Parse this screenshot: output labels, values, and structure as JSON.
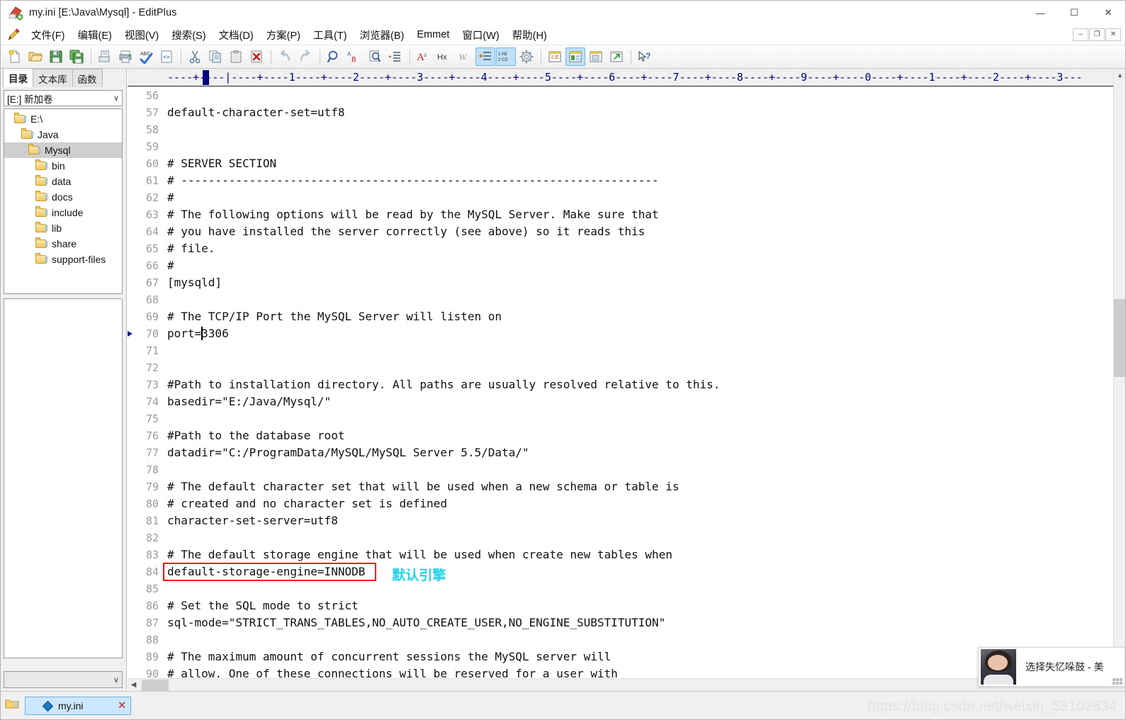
{
  "window": {
    "title": "my.ini [E:\\Java\\Mysql] - EditPlus",
    "app_icon": "editplus-icon",
    "controls": {
      "minimize": "—",
      "maximize": "☐",
      "close": "✕"
    },
    "mdi_controls": {
      "minimize": "–",
      "restore": "❐",
      "close": "✕"
    }
  },
  "menubar": {
    "items": [
      {
        "label": "文件(F)",
        "name": "menu-file"
      },
      {
        "label": "编辑(E)",
        "name": "menu-edit"
      },
      {
        "label": "视图(V)",
        "name": "menu-view"
      },
      {
        "label": "搜索(S)",
        "name": "menu-search"
      },
      {
        "label": "文档(D)",
        "name": "menu-document"
      },
      {
        "label": "方案(P)",
        "name": "menu-project"
      },
      {
        "label": "工具(T)",
        "name": "menu-tools"
      },
      {
        "label": "浏览器(B)",
        "name": "menu-browser"
      },
      {
        "label": "Emmet",
        "name": "menu-emmet"
      },
      {
        "label": "窗口(W)",
        "name": "menu-window"
      },
      {
        "label": "帮助(H)",
        "name": "menu-help"
      }
    ]
  },
  "toolbar": {
    "buttons": [
      {
        "name": "new-file-icon",
        "glyph": "new",
        "active": false
      },
      {
        "name": "open-file-icon",
        "glyph": "open",
        "active": false
      },
      {
        "name": "save-icon",
        "glyph": "save",
        "active": false
      },
      {
        "name": "save-all-icon",
        "glyph": "saveall",
        "active": false
      },
      {
        "name": "sep",
        "glyph": "sep",
        "active": false
      },
      {
        "name": "print-preview-icon",
        "glyph": "preview",
        "active": false
      },
      {
        "name": "print-icon",
        "glyph": "print",
        "active": false
      },
      {
        "name": "spell-check-icon",
        "glyph": "spell",
        "active": false
      },
      {
        "name": "html-tag-icon",
        "glyph": "tag",
        "active": false
      },
      {
        "name": "sep",
        "glyph": "sep",
        "active": false
      },
      {
        "name": "cut-icon",
        "glyph": "cut",
        "active": false
      },
      {
        "name": "copy-icon",
        "glyph": "copy",
        "active": false
      },
      {
        "name": "paste-icon",
        "glyph": "paste",
        "active": false
      },
      {
        "name": "delete-icon",
        "glyph": "delete",
        "active": false
      },
      {
        "name": "sep",
        "glyph": "sep",
        "active": false
      },
      {
        "name": "undo-icon",
        "glyph": "undo",
        "active": false
      },
      {
        "name": "redo-icon",
        "glyph": "redo",
        "active": false
      },
      {
        "name": "sep",
        "glyph": "sep",
        "active": false
      },
      {
        "name": "find-icon",
        "glyph": "find",
        "active": false
      },
      {
        "name": "replace-icon",
        "glyph": "replace",
        "active": false
      },
      {
        "name": "find-in-files-icon",
        "glyph": "findfiles",
        "active": false
      },
      {
        "name": "goto-line-icon",
        "glyph": "goto",
        "active": false
      },
      {
        "name": "sep",
        "glyph": "sep",
        "active": false
      },
      {
        "name": "font-icon",
        "glyph": "font",
        "active": false
      },
      {
        "name": "hex-view-icon",
        "glyph": "hex",
        "active": false
      },
      {
        "name": "word-wrap-icon",
        "glyph": "wordwrap",
        "active": false
      },
      {
        "name": "indent-icon",
        "glyph": "indent",
        "active": true
      },
      {
        "name": "line-numbers-icon",
        "glyph": "linenum",
        "active": true
      },
      {
        "name": "preferences-icon",
        "glyph": "gear",
        "active": false
      },
      {
        "name": "sep",
        "glyph": "sep",
        "active": false
      },
      {
        "name": "directory-window-icon",
        "glyph": "dirwin",
        "active": false
      },
      {
        "name": "output-window-icon",
        "glyph": "outwin",
        "active": true
      },
      {
        "name": "clipboard-window-icon",
        "glyph": "clipwin",
        "active": false
      },
      {
        "name": "browser-preview-icon",
        "glyph": "browse",
        "active": false
      },
      {
        "name": "sep",
        "glyph": "sep",
        "active": false
      },
      {
        "name": "context-help-icon",
        "glyph": "help",
        "active": false
      }
    ]
  },
  "sidebar": {
    "tabs": [
      {
        "label": "目录",
        "selected": true
      },
      {
        "label": "文本库",
        "selected": false
      },
      {
        "label": "函数",
        "selected": false
      }
    ],
    "drive_selector": {
      "value": "[E:] 新加卷",
      "caret": "∨"
    },
    "tree": [
      {
        "label": "E:\\",
        "indent": 0,
        "selected": false
      },
      {
        "label": "Java",
        "indent": 1,
        "selected": false
      },
      {
        "label": "Mysql",
        "indent": 2,
        "selected": true
      },
      {
        "label": "bin",
        "indent": 3,
        "selected": false
      },
      {
        "label": "data",
        "indent": 3,
        "selected": false
      },
      {
        "label": "docs",
        "indent": 3,
        "selected": false
      },
      {
        "label": "include",
        "indent": 3,
        "selected": false
      },
      {
        "label": "lib",
        "indent": 3,
        "selected": false
      },
      {
        "label": "share",
        "indent": 3,
        "selected": false
      },
      {
        "label": "support-files",
        "indent": 3,
        "selected": false
      }
    ],
    "filter_combo": {
      "value": "",
      "caret": "∨"
    }
  },
  "ruler": {
    "text": "----+----|----+----1----+----2----+----3----+----4----+----5----+----6----+----7----+----8----+----9----+----0----+----1----+----2----+----3---",
    "cursor_column": 9
  },
  "editor": {
    "lines": [
      {
        "no": "56",
        "text": ""
      },
      {
        "no": "57",
        "text": "default-character-set=utf8"
      },
      {
        "no": "58",
        "text": ""
      },
      {
        "no": "59",
        "text": ""
      },
      {
        "no": "60",
        "text": "# SERVER SECTION"
      },
      {
        "no": "61",
        "text": "# ----------------------------------------------------------------------"
      },
      {
        "no": "62",
        "text": "#"
      },
      {
        "no": "63",
        "text": "# The following options will be read by the MySQL Server. Make sure that"
      },
      {
        "no": "64",
        "text": "# you have installed the server correctly (see above) so it reads this"
      },
      {
        "no": "65",
        "text": "# file."
      },
      {
        "no": "66",
        "text": "#"
      },
      {
        "no": "67",
        "text": "[mysqld]"
      },
      {
        "no": "68",
        "text": ""
      },
      {
        "no": "69",
        "text": "# The TCP/IP Port the MySQL Server will listen on"
      },
      {
        "no": "70",
        "text": "port=3306",
        "bookmark": true,
        "caret_after": 5
      },
      {
        "no": "71",
        "text": ""
      },
      {
        "no": "72",
        "text": ""
      },
      {
        "no": "73",
        "text": "#Path to installation directory. All paths are usually resolved relative to this."
      },
      {
        "no": "74",
        "text": "basedir=\"E:/Java/Mysql/\""
      },
      {
        "no": "75",
        "text": ""
      },
      {
        "no": "76",
        "text": "#Path to the database root"
      },
      {
        "no": "77",
        "text": "datadir=\"C:/ProgramData/MySQL/MySQL Server 5.5/Data/\""
      },
      {
        "no": "78",
        "text": ""
      },
      {
        "no": "79",
        "text": "# The default character set that will be used when a new schema or table is"
      },
      {
        "no": "80",
        "text": "# created and no character set is defined"
      },
      {
        "no": "81",
        "text": "character-set-server=utf8"
      },
      {
        "no": "82",
        "text": ""
      },
      {
        "no": "83",
        "text": "# The default storage engine that will be used when create new tables when"
      },
      {
        "no": "84",
        "text": "default-storage-engine=INNODB"
      },
      {
        "no": "85",
        "text": ""
      },
      {
        "no": "86",
        "text": "# Set the SQL mode to strict"
      },
      {
        "no": "87",
        "text": "sql-mode=\"STRICT_TRANS_TABLES,NO_AUTO_CREATE_USER,NO_ENGINE_SUBSTITUTION\""
      },
      {
        "no": "88",
        "text": ""
      },
      {
        "no": "89",
        "text": "# The maximum amount of concurrent sessions the MySQL server will"
      },
      {
        "no": "90",
        "text": "# allow. One of these connections will be reserved for a user with"
      }
    ],
    "annotations": [
      {
        "type": "highlight-box",
        "target_line": "84",
        "color": "#ff0000",
        "label": "默认引擎",
        "label_color": "#22d3e8"
      }
    ]
  },
  "bottom_bar": {
    "document_tabs": [
      {
        "label": "my.ini",
        "selected": true,
        "close_glyph": "✕"
      }
    ]
  },
  "float_widget": {
    "title": "选择失忆哚鼓 - 美",
    "thumbnail": "album-art-photo"
  },
  "watermark": "https://blog.csdn.net/weixin_53102634",
  "colors": {
    "accent": "#cce8ff",
    "annotation_red": "#ff0000",
    "annotation_cyan": "#22d3e8",
    "ruler_blue": "#00007f",
    "gutter_gray": "#9b9b9b"
  }
}
